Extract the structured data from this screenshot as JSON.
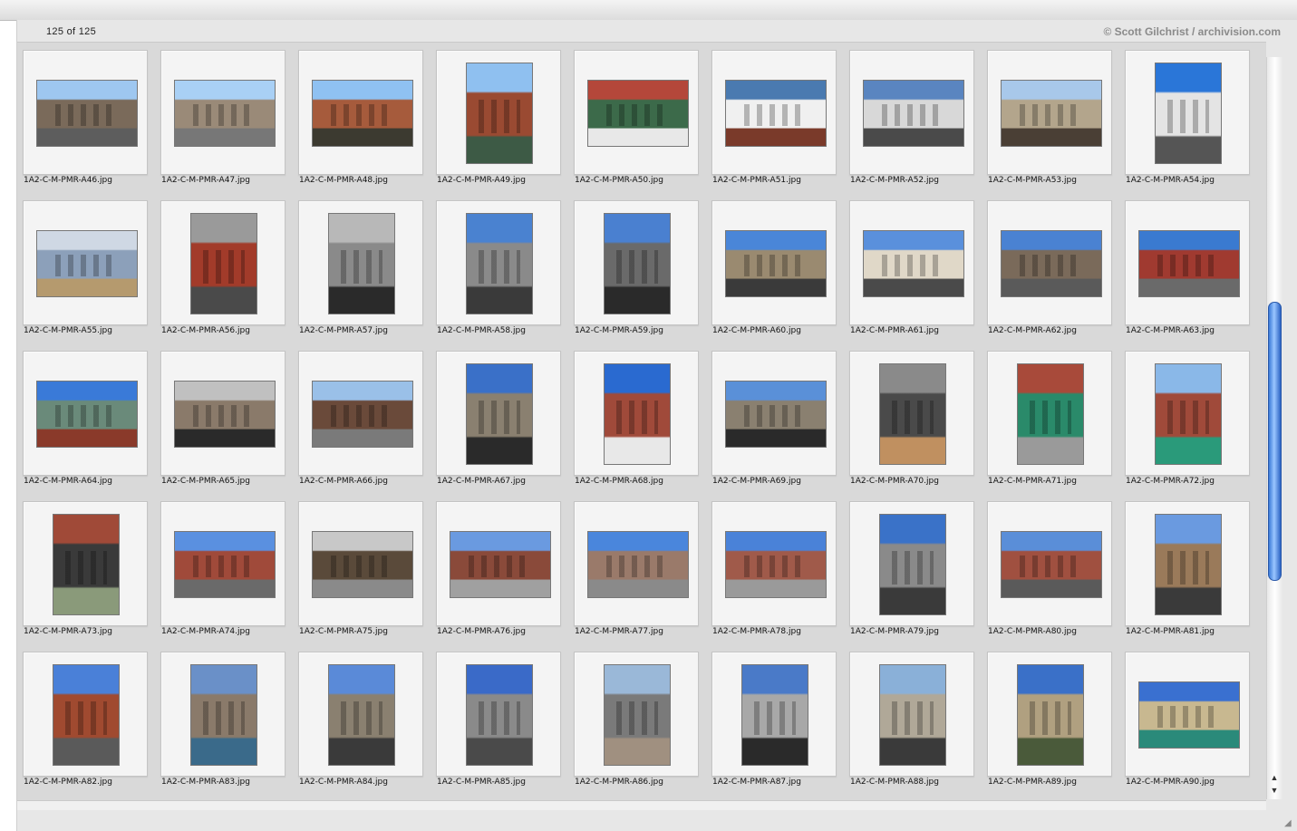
{
  "status": {
    "count_text": "125 of 125",
    "copyright": "© Scott Gilchrist / archivision.com"
  },
  "colors": {
    "selection_blue": "#3a7ad8",
    "panel_bg": "#e7e7e7"
  },
  "icons": {
    "scroll_up": "triangle-up",
    "scroll_down": "triangle-down",
    "resize": "resize-grip"
  },
  "images": [
    {
      "name": "1A2-C-M-PMR-A46.jpg",
      "orient": "land",
      "colors": [
        "#9ec7f0",
        "#7a6a5a",
        "#5d5d5d"
      ]
    },
    {
      "name": "1A2-C-M-PMR-A47.jpg",
      "orient": "land",
      "colors": [
        "#a9d0f5",
        "#9a8a78",
        "#777777"
      ]
    },
    {
      "name": "1A2-C-M-PMR-A48.jpg",
      "orient": "land",
      "colors": [
        "#8fc1f2",
        "#a65b3c",
        "#3c3a30"
      ]
    },
    {
      "name": "1A2-C-M-PMR-A49.jpg",
      "orient": "port",
      "colors": [
        "#8fc0f0",
        "#9a4a32",
        "#3d5a45"
      ]
    },
    {
      "name": "1A2-C-M-PMR-A50.jpg",
      "orient": "land",
      "colors": [
        "#b4473a",
        "#3c6a4a",
        "#e8e8e8"
      ]
    },
    {
      "name": "1A2-C-M-PMR-A51.jpg",
      "orient": "land",
      "colors": [
        "#4a7ab0",
        "#f0f0f0",
        "#7a3a2a"
      ]
    },
    {
      "name": "1A2-C-M-PMR-A52.jpg",
      "orient": "land",
      "colors": [
        "#5a85c0",
        "#d8d8d8",
        "#4a4a4a"
      ]
    },
    {
      "name": "1A2-C-M-PMR-A53.jpg",
      "orient": "land",
      "colors": [
        "#a8c8ea",
        "#b3a58c",
        "#4a3f35"
      ]
    },
    {
      "name": "1A2-C-M-PMR-A54.jpg",
      "orient": "port",
      "colors": [
        "#2a76d8",
        "#e4e4e4",
        "#555555"
      ]
    },
    {
      "name": "1A2-C-M-PMR-A55.jpg",
      "orient": "land",
      "colors": [
        "#cfd8e4",
        "#8ca0ba",
        "#b59a6e"
      ]
    },
    {
      "name": "1A2-C-M-PMR-A56.jpg",
      "orient": "port",
      "colors": [
        "#9a9a9a",
        "#a23b2a",
        "#4a4a4a"
      ]
    },
    {
      "name": "1A2-C-M-PMR-A57.jpg",
      "orient": "port",
      "colors": [
        "#b8b8b8",
        "#8a8a8a",
        "#2a2a2a"
      ]
    },
    {
      "name": "1A2-C-M-PMR-A58.jpg",
      "orient": "port",
      "colors": [
        "#4a82d0",
        "#8a8a8a",
        "#3a3a3a"
      ]
    },
    {
      "name": "1A2-C-M-PMR-A59.jpg",
      "orient": "port",
      "colors": [
        "#4a80d0",
        "#6a6a6a",
        "#2a2a2a"
      ]
    },
    {
      "name": "1A2-C-M-PMR-A60.jpg",
      "orient": "land",
      "colors": [
        "#4a86d8",
        "#9a8a70",
        "#3a3a3a"
      ]
    },
    {
      "name": "1A2-C-M-PMR-A61.jpg",
      "orient": "land",
      "colors": [
        "#5a90dc",
        "#e0d8c8",
        "#4a4a4a"
      ]
    },
    {
      "name": "1A2-C-M-PMR-A62.jpg",
      "orient": "land",
      "colors": [
        "#4a82d2",
        "#7a6a5a",
        "#5a5a5a"
      ]
    },
    {
      "name": "1A2-C-M-PMR-A63.jpg",
      "orient": "land",
      "colors": [
        "#3a7ad0",
        "#a03a30",
        "#6a6a6a"
      ]
    },
    {
      "name": "1A2-C-M-PMR-A64.jpg",
      "orient": "land",
      "colors": [
        "#3a7ad8",
        "#6a8a7a",
        "#8a3a2a"
      ]
    },
    {
      "name": "1A2-C-M-PMR-A65.jpg",
      "orient": "land",
      "colors": [
        "#c0c0c0",
        "#8a7a6a",
        "#2a2a2a"
      ]
    },
    {
      "name": "1A2-C-M-PMR-A66.jpg",
      "orient": "land",
      "colors": [
        "#9ac0e8",
        "#6a4a3a",
        "#7a7a7a"
      ]
    },
    {
      "name": "1A2-C-M-PMR-A67.jpg",
      "orient": "port",
      "colors": [
        "#3a70c8",
        "#8a8070",
        "#2a2a2a"
      ]
    },
    {
      "name": "1A2-C-M-PMR-A68.jpg",
      "orient": "port",
      "colors": [
        "#2a6ad0",
        "#a04a3a",
        "#e8e8e8"
      ]
    },
    {
      "name": "1A2-C-M-PMR-A69.jpg",
      "orient": "land",
      "colors": [
        "#5a90d8",
        "#8a8070",
        "#2a2a2a"
      ]
    },
    {
      "name": "1A2-C-M-PMR-A70.jpg",
      "orient": "port",
      "colors": [
        "#8a8a8a",
        "#4a4a4a",
        "#c09060"
      ]
    },
    {
      "name": "1A2-C-M-PMR-A71.jpg",
      "orient": "port",
      "colors": [
        "#a84a3a",
        "#2a8a6a",
        "#9a9a9a"
      ]
    },
    {
      "name": "1A2-C-M-PMR-A72.jpg",
      "orient": "port",
      "colors": [
        "#8ab8e8",
        "#a04a3a",
        "#2a9a7a"
      ]
    },
    {
      "name": "1A2-C-M-PMR-A73.jpg",
      "orient": "port",
      "colors": [
        "#a04a38",
        "#3a3a3a",
        "#8a9a7a"
      ]
    },
    {
      "name": "1A2-C-M-PMR-A74.jpg",
      "orient": "land",
      "colors": [
        "#5a90e0",
        "#a04a3a",
        "#6a6a6a"
      ]
    },
    {
      "name": "1A2-C-M-PMR-A75.jpg",
      "orient": "land",
      "colors": [
        "#c8c8c8",
        "#5a4a3a",
        "#8a8a8a"
      ]
    },
    {
      "name": "1A2-C-M-PMR-A76.jpg",
      "orient": "land",
      "colors": [
        "#6a9ae0",
        "#8a4a3a",
        "#a0a0a0"
      ]
    },
    {
      "name": "1A2-C-M-PMR-A77.jpg",
      "orient": "land",
      "colors": [
        "#4a86dc",
        "#9a7a6a",
        "#8a8a8a"
      ]
    },
    {
      "name": "1A2-C-M-PMR-A78.jpg",
      "orient": "land",
      "colors": [
        "#4a82d8",
        "#a05a4a",
        "#9a9a9a"
      ]
    },
    {
      "name": "1A2-C-M-PMR-A79.jpg",
      "orient": "port",
      "colors": [
        "#3a72c8",
        "#8a8a8a",
        "#3a3a3a"
      ]
    },
    {
      "name": "1A2-C-M-PMR-A80.jpg",
      "orient": "land",
      "colors": [
        "#5a8ed8",
        "#a05040",
        "#5a5a5a"
      ]
    },
    {
      "name": "1A2-C-M-PMR-A81.jpg",
      "orient": "port",
      "colors": [
        "#6a9ae0",
        "#9a7a5a",
        "#3a3a3a"
      ]
    },
    {
      "name": "1A2-C-M-PMR-A82.jpg",
      "orient": "port",
      "colors": [
        "#4a80d8",
        "#a04a30",
        "#5a5a5a"
      ]
    },
    {
      "name": "1A2-C-M-PMR-A83.jpg",
      "orient": "port",
      "colors": [
        "#6a90c8",
        "#8a7a6a",
        "#3a6a8a"
      ]
    },
    {
      "name": "1A2-C-M-PMR-A84.jpg",
      "orient": "port",
      "colors": [
        "#5a8ad8",
        "#8a8070",
        "#3a3a3a"
      ]
    },
    {
      "name": "1A2-C-M-PMR-A85.jpg",
      "orient": "port",
      "colors": [
        "#3a6ac8",
        "#8a8a8a",
        "#4a4a4a"
      ]
    },
    {
      "name": "1A2-C-M-PMR-A86.jpg",
      "orient": "port",
      "colors": [
        "#9ab8d8",
        "#7a7a7a",
        "#a09080"
      ]
    },
    {
      "name": "1A2-C-M-PMR-A87.jpg",
      "orient": "port",
      "colors": [
        "#4a7ac8",
        "#a8a8a8",
        "#2a2a2a"
      ]
    },
    {
      "name": "1A2-C-M-PMR-A88.jpg",
      "orient": "port",
      "colors": [
        "#8ab0d8",
        "#b0a898",
        "#3a3a3a"
      ]
    },
    {
      "name": "1A2-C-M-PMR-A89.jpg",
      "orient": "port",
      "colors": [
        "#3a70c8",
        "#b0a080",
        "#4a5a3a"
      ]
    },
    {
      "name": "1A2-C-M-PMR-A90.jpg",
      "orient": "land",
      "colors": [
        "#3a70d0",
        "#c8b890",
        "#2a8a7a"
      ]
    }
  ]
}
